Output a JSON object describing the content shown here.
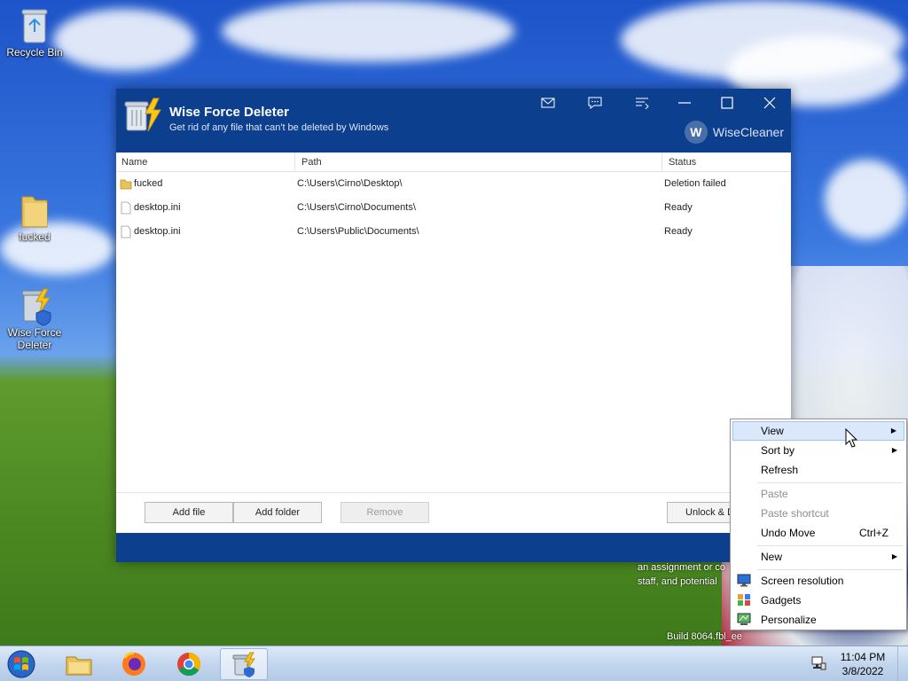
{
  "desktop": {
    "icons": [
      {
        "label": "Recycle Bin"
      },
      {
        "label": "fucked"
      },
      {
        "label": "Wise Force Deleter"
      }
    ],
    "watermark": {
      "line1": "an assignment or co",
      "line2": "staff, and potential",
      "build": "Build 8064.fbl_ee"
    }
  },
  "window": {
    "title": "Wise Force Deleter",
    "subtitle": "Get rid of any file that can't be deleted by Windows",
    "brand": "WiseCleaner",
    "brand_mark": "W",
    "columns": {
      "name": "Name",
      "path": "Path",
      "status": "Status"
    },
    "rows": [
      {
        "name": "fucked",
        "path": "C:\\Users\\Cirno\\Desktop\\",
        "status": "Deletion failed",
        "icon": "folder-icon"
      },
      {
        "name": "desktop.ini",
        "path": "C:\\Users\\Cirno\\Documents\\",
        "status": "Ready",
        "icon": "file-icon"
      },
      {
        "name": "desktop.ini",
        "path": "C:\\Users\\Public\\Documents\\",
        "status": "Ready",
        "icon": "file-icon"
      }
    ],
    "buttons": {
      "add_file": "Add file",
      "add_folder": "Add folder",
      "remove": "Remove",
      "unlock": "Unlock & D"
    }
  },
  "context_menu": {
    "items": [
      {
        "label": "View",
        "submenu": true
      },
      {
        "label": "Sort by",
        "submenu": true
      },
      {
        "label": "Refresh"
      },
      {
        "label": "Paste",
        "disabled": true
      },
      {
        "label": "Paste shortcut",
        "disabled": true
      },
      {
        "label": "Undo Move",
        "shortcut": "Ctrl+Z"
      },
      {
        "label": "New",
        "submenu": true
      },
      {
        "label": "Screen resolution",
        "icon": "screen-resolution-icon"
      },
      {
        "label": "Gadgets",
        "icon": "gadgets-icon"
      },
      {
        "label": "Personalize",
        "icon": "personalize-icon"
      }
    ],
    "arrow": "▶"
  },
  "taskbar": {
    "clock_time": "11:04 PM",
    "clock_date": "3/8/2022"
  },
  "colors": {
    "header_blue": "#0d3f8f",
    "menu_highlight": "#dbe8fb"
  }
}
